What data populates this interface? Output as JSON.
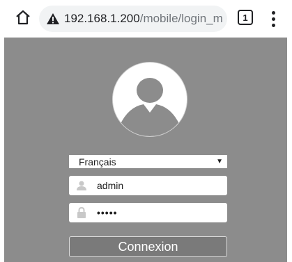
{
  "browser": {
    "url_host": "192.168.1.200",
    "url_path": "/mobile/login_m",
    "tab_count": "1",
    "icons": [
      "home-icon",
      "warning-icon",
      "tabs-icon",
      "more-vert-icon"
    ]
  },
  "login": {
    "language_selected": "Français",
    "username_value": "admin",
    "password_value": "•••••",
    "submit_label": "Connexion",
    "icons": [
      "avatar-icon",
      "user-icon",
      "lock-icon",
      "caret-down-icon"
    ]
  },
  "colors": {
    "page_background": "#8c8c8c",
    "button_background": "#7a7a7a",
    "field_background": "#ffffff"
  }
}
